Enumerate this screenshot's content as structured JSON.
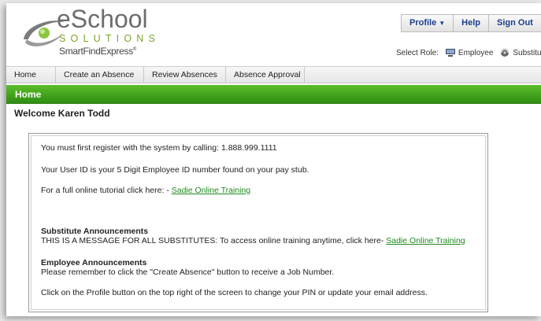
{
  "brand": {
    "title": "eSchool",
    "solutions": "SOLUTIONS",
    "product": "SmartFindExpress",
    "tm": "®",
    "colors": {
      "gray": "#6d6d6d",
      "green": "#7aa629"
    }
  },
  "top_buttons": {
    "profile": "Profile",
    "help": "Help",
    "signout": "Sign Out"
  },
  "role": {
    "label": "Select Role:",
    "employee": "Employee",
    "substitute": "Substitute"
  },
  "nav": {
    "home": "Home",
    "create": "Create an Absence",
    "review": "Review Absences",
    "approval": "Absence Approval"
  },
  "section": {
    "title": "Home",
    "color": "#3ea31c"
  },
  "welcome": "Welcome Karen Todd",
  "messages": {
    "register": "You must first register with the system by calling: 1.888.999.1111",
    "userid": "Your User ID is your 5 Digit Employee ID number found on your pay stub.",
    "tutorial_prefix": "For a full online tutorial click here: - ",
    "tutorial_link": "Sadie Online Training",
    "sub_heading": "Substitute Announcements",
    "sub_text": "THIS IS A MESSAGE FOR ALL SUBSTITUTES: To access online training anytime, click here- ",
    "sub_link": "Sadie Online Training",
    "emp_heading": "Employee Announcements",
    "emp_text": "Please remember to click the \"Create Absence\" button to receive a Job Number.",
    "profile_note": "Click on the Profile button on the top right of the screen to change your PIN or update your email address."
  },
  "icons": {
    "employee": "employee-icon",
    "substitute": "substitute-icon",
    "logo": "swoosh-logo-icon",
    "caret": "chevron-down-icon"
  }
}
